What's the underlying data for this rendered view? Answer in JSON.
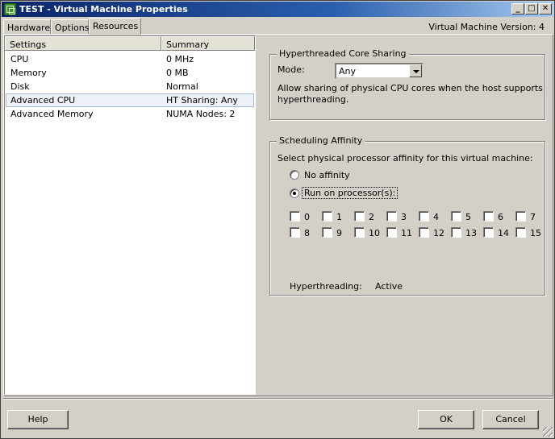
{
  "window": {
    "title": "TEST - Virtual Machine Properties",
    "icon": "vm-properties-icon",
    "controls": {
      "minimize": "_",
      "maximize": "□",
      "close": "✕"
    }
  },
  "tabs": [
    "Hardware",
    "Options",
    "Resources"
  ],
  "active_tab": "Resources",
  "version_label": "Virtual Machine Version: 4",
  "list": {
    "headers": {
      "settings": "Settings",
      "summary": "Summary"
    },
    "rows": [
      {
        "setting": "CPU",
        "summary": "0 MHz"
      },
      {
        "setting": "Memory",
        "summary": "0 MB"
      },
      {
        "setting": "Disk",
        "summary": "Normal"
      },
      {
        "setting": "Advanced CPU",
        "summary": "HT Sharing: Any"
      },
      {
        "setting": "Advanced Memory",
        "summary": "NUMA Nodes: 2"
      }
    ],
    "selected": "Advanced CPU"
  },
  "ht_sharing": {
    "legend": "Hyperthreaded Core Sharing",
    "mode_label": "Mode:",
    "mode_value": "Any",
    "description_line1": "Allow sharing of physical CPU cores when the host supports",
    "description_line2": "hyperthreading."
  },
  "affinity": {
    "legend": "Scheduling Affinity",
    "prompt": "Select physical processor affinity for this virtual machine:",
    "options": [
      "No affinity",
      "Run on processor(s):"
    ],
    "selected_option": "Run on processor(s):",
    "processors": [
      "0",
      "1",
      "2",
      "3",
      "4",
      "5",
      "6",
      "7",
      "8",
      "9",
      "10",
      "11",
      "12",
      "13",
      "14",
      "15"
    ],
    "hyperthreading_label": "Hyperthreading:",
    "hyperthreading_value": "Active"
  },
  "buttons": {
    "help": "Help",
    "ok": "OK",
    "cancel": "Cancel"
  }
}
